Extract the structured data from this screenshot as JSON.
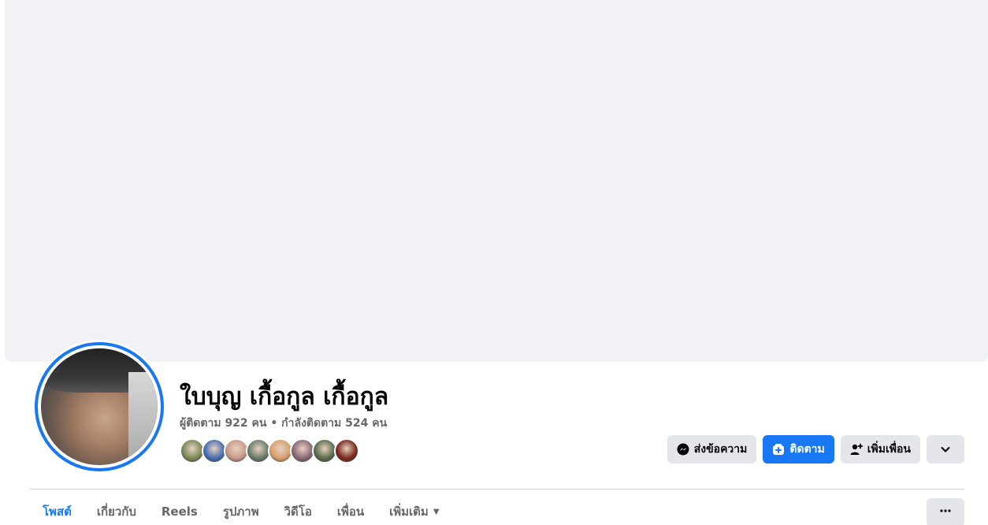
{
  "profile": {
    "name": "ใบบุญ เกื้อกูล เกื้อกูล",
    "stats": "ผู้ติดตาม 922 คน • กำลังติดตาม 524 คน"
  },
  "friends": [
    {
      "color": "#7b8a5a"
    },
    {
      "color": "#4a6fb0"
    },
    {
      "color": "#c99a8a"
    },
    {
      "color": "#6b7d6a"
    },
    {
      "color": "#d8a070"
    },
    {
      "color": "#8a6a7a"
    },
    {
      "color": "#5b6e4e"
    },
    {
      "color": "#7a2a20"
    }
  ],
  "actions": {
    "message_label": "ส่งข้อความ",
    "follow_label": "ติดตาม",
    "add_friend_label": "เพิ่มเพื่อน"
  },
  "tabs": [
    {
      "label": "โพสต์"
    },
    {
      "label": "เกี่ยวกับ"
    },
    {
      "label": "Reels"
    },
    {
      "label": "รูปภาพ"
    },
    {
      "label": "วิดีโอ"
    },
    {
      "label": "เพื่อน"
    },
    {
      "label": "เพิ่มเติม"
    }
  ],
  "colors": {
    "accent": "#1877f2",
    "cover": "#f0f2f5",
    "secondary_text": "#65676b"
  }
}
